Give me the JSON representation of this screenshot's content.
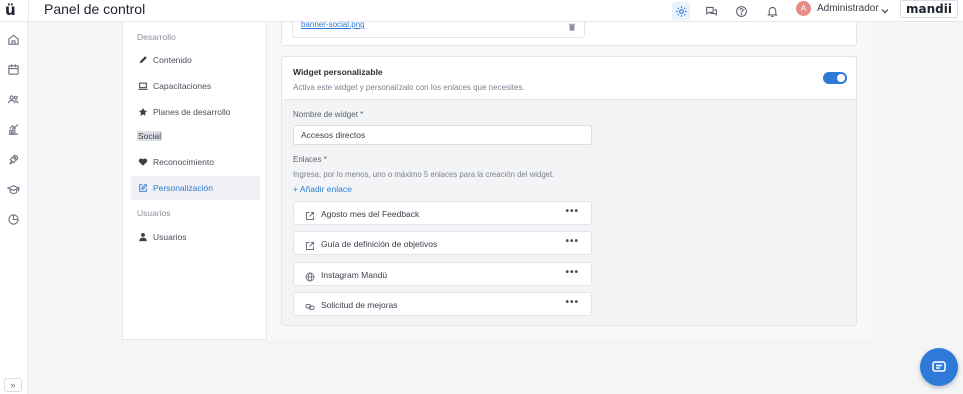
{
  "header": {
    "logo": "ü",
    "title": "Panel de control",
    "icons": [
      "gear-icon",
      "chat-icon",
      "help-icon",
      "bell-icon"
    ],
    "user": {
      "initial": "A",
      "name": "Administrador"
    },
    "brand": "mandii"
  },
  "rail": {
    "icons": [
      "home-icon",
      "calendar-icon",
      "people-icon",
      "chart-icon",
      "rocket-icon",
      "graduation-icon",
      "pie-icon"
    ],
    "expand_label": "»"
  },
  "subnav": {
    "sections": [
      "Desarrollo",
      "Social",
      "Usuarios"
    ],
    "items": [
      {
        "label": "Contenido",
        "icon": "pen-icon"
      },
      {
        "label": "Capacitaciones",
        "icon": "laptop-icon"
      },
      {
        "label": "Planes de desarrollo",
        "icon": "star-icon"
      },
      {
        "label": "Reconocimiento",
        "icon": "heart-icon"
      },
      {
        "label": "Personalización",
        "icon": "edit-icon",
        "active": true
      },
      {
        "label": "Usuarios",
        "icon": "user-icon"
      }
    ]
  },
  "previous": {
    "file_name": "banner-social.png"
  },
  "widget": {
    "title": "Widget personalizable",
    "description": "Activa este widget y personalízalo con los enlaces que necesites.",
    "enabled": true,
    "name_label": "Nombre de widget *",
    "name_value": "Accesos directos",
    "links_label": "Enlaces *",
    "links_help": "Ingresa, por lo menos, uno o máximo 5 enlaces para la creación del widget.",
    "add_link": "+ Añadir enlace",
    "links": [
      {
        "label": "Agosto mes del Feedback",
        "icon": "external-link-icon"
      },
      {
        "label": "Guía de definición de objetivos",
        "icon": "external-link-icon"
      },
      {
        "label": "Instagram Mandü",
        "icon": "globe-icon"
      },
      {
        "label": "Solicitud de mejoras",
        "icon": "chain-link-icon"
      }
    ],
    "more": "•••"
  },
  "colors": {
    "accent": "#2f7ad8",
    "avatar": "#e88b8b"
  }
}
